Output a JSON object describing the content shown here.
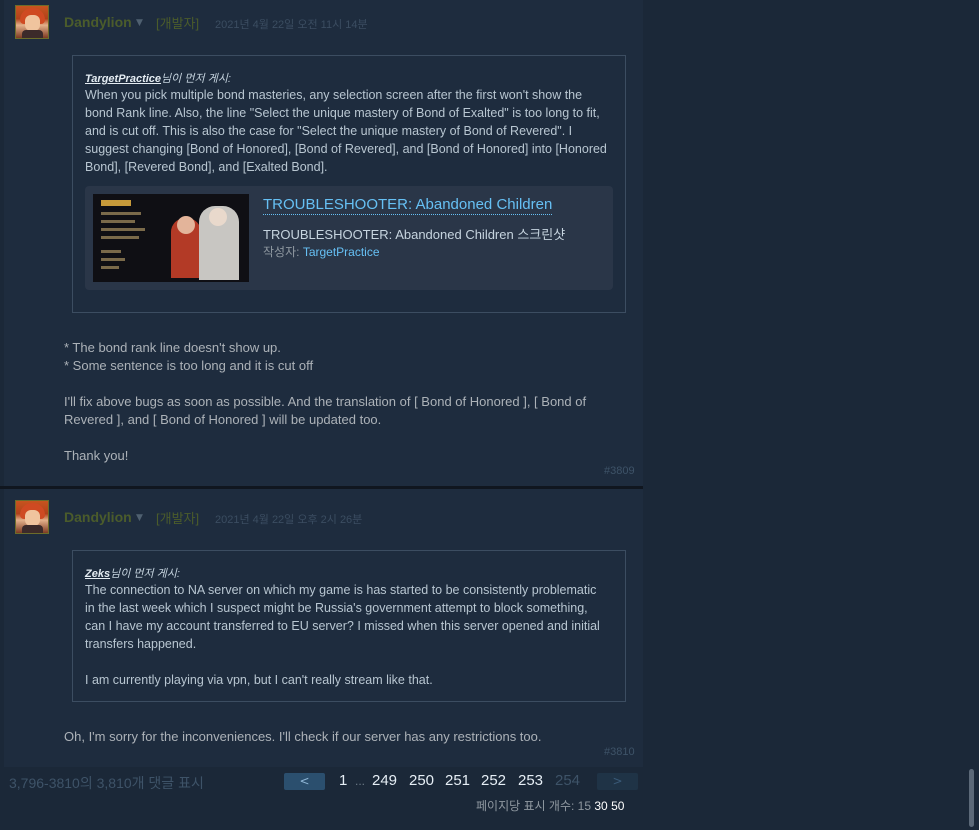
{
  "post1": {
    "author": "Dandylion",
    "role_badge": "[개발자]",
    "timestamp": "2021년 4월 22일 오전 11시 14분",
    "quote": {
      "original_poster": "TargetPractice",
      "suffix": "님이 먼저 게시:",
      "lines": [
        "When you pick multiple bond masteries, any selection screen after the first won't show the",
        "bond Rank line. Also, the line \"Select the unique mastery of Bond of Exalted\" is too long to fit,",
        "and is cut off. This is also the case for \"Select the unique mastery of Bond of Revered\". I",
        "suggest changing [Bond of Honored], [Bond of Revered], and [Bond of Honored] into [Honored",
        "Bond], [Revered Bond], and [Exalted Bond]."
      ]
    },
    "embed": {
      "title": "TROUBLESHOOTER: Abandoned Children",
      "subtitle": "TROUBLESHOOTER: Abandoned Children 스크린샷",
      "author_prefix": "작성자:",
      "author": "TargetPractice"
    },
    "body": {
      "line1": "* The bond rank line doesn't show up.",
      "line2": "* Some sentence is too long and it is cut off",
      "line3": "I'll fix above bugs as soon as possible. And the translation of [ Bond of Honored ], [ Bond of",
      "line4": "Revered ], and [ Bond of Honored ] will be updated too.",
      "line5": "Thank you!"
    },
    "comment_number": "#3809"
  },
  "post2": {
    "author": "Dandylion",
    "role_badge": "[개발자]",
    "timestamp": "2021년 4월 22일 오후 2시 26분",
    "quote": {
      "original_poster": "Zeks",
      "suffix": "님이 먼저 게시:",
      "lines": [
        "The connection to NA server on which my game is has started to be consistently problematic",
        "in the last week which I suspect might be Russia's government attempt to block something,",
        "can I have my account transferred to EU server? I missed when this server opened and initial",
        "transfers happened.",
        "",
        "I am currently playing via vpn, but I can't really stream like that."
      ]
    },
    "body": {
      "line1": "Oh, I'm sorry for the inconveniences. I'll check if our server has any restrictions too."
    },
    "comment_number": "#3810"
  },
  "pagination": {
    "showing": "3,796-3810의 3,810개 댓글 표시",
    "prev_label": "<",
    "next_label": ">",
    "pages": [
      "1",
      "...",
      "249",
      "250",
      "251",
      "252",
      "253",
      "254"
    ],
    "current_page": "254",
    "per_page_label": "페이지당 표시 개수:",
    "per_page_options": [
      "15",
      "30",
      "50"
    ]
  }
}
